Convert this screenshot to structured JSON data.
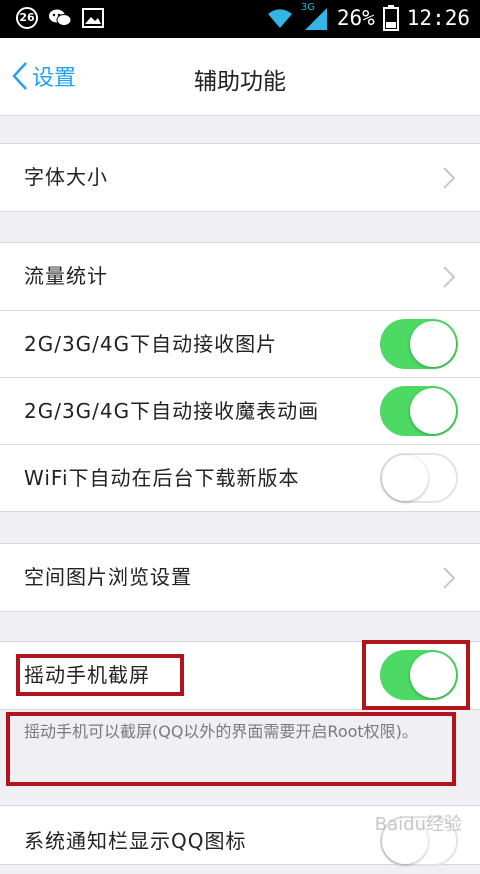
{
  "status_bar": {
    "badge": "26",
    "signal_tag": "3G",
    "battery": "26%",
    "time": "12:26"
  },
  "nav": {
    "back_label": "设置",
    "title": "辅助功能"
  },
  "groups": {
    "font": {
      "label": "字体大小"
    },
    "traffic": {
      "label": "流量统计"
    },
    "auto_image": {
      "label": "2G/3G/4G下自动接收图片",
      "state": "on"
    },
    "auto_emoticon": {
      "label": "2G/3G/4G下自动接收魔表动画",
      "state": "on"
    },
    "wifi_update": {
      "label": "WiFi下自动在后台下载新版本",
      "state": "off"
    },
    "space_photo": {
      "label": "空间图片浏览设置"
    },
    "shake_screenshot": {
      "label": "摇动手机截屏",
      "state": "on",
      "description": "摇动手机可以截屏(QQ以外的界面需要开启Root权限)。"
    },
    "notify_icon": {
      "label": "系统通知栏显示QQ图标"
    }
  },
  "watermark": "Baidu经验",
  "colors": {
    "accent": "#1ea3f2",
    "switch_on": "#4cd964",
    "highlight": "#b0141d"
  }
}
